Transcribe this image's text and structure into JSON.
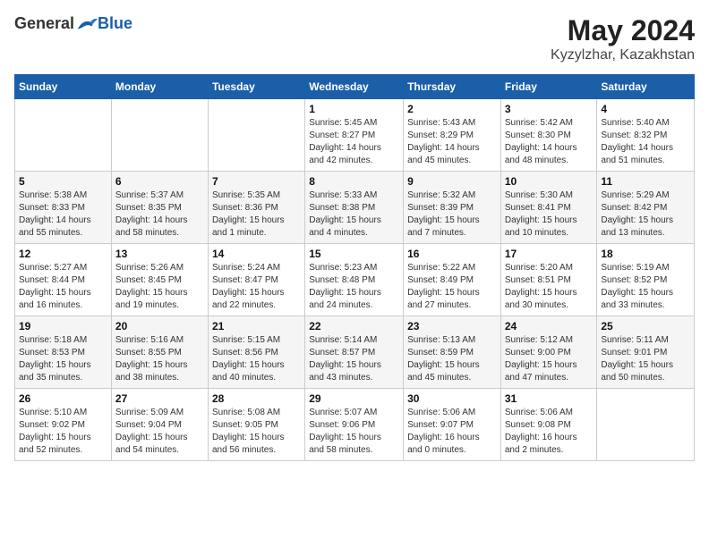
{
  "logo": {
    "general": "General",
    "blue": "Blue"
  },
  "title": {
    "month_year": "May 2024",
    "location": "Kyzylzhar, Kazakhstan"
  },
  "header_days": [
    "Sunday",
    "Monday",
    "Tuesday",
    "Wednesday",
    "Thursday",
    "Friday",
    "Saturday"
  ],
  "weeks": [
    [
      {
        "day": "",
        "info": ""
      },
      {
        "day": "",
        "info": ""
      },
      {
        "day": "",
        "info": ""
      },
      {
        "day": "1",
        "info": "Sunrise: 5:45 AM\nSunset: 8:27 PM\nDaylight: 14 hours\nand 42 minutes."
      },
      {
        "day": "2",
        "info": "Sunrise: 5:43 AM\nSunset: 8:29 PM\nDaylight: 14 hours\nand 45 minutes."
      },
      {
        "day": "3",
        "info": "Sunrise: 5:42 AM\nSunset: 8:30 PM\nDaylight: 14 hours\nand 48 minutes."
      },
      {
        "day": "4",
        "info": "Sunrise: 5:40 AM\nSunset: 8:32 PM\nDaylight: 14 hours\nand 51 minutes."
      }
    ],
    [
      {
        "day": "5",
        "info": "Sunrise: 5:38 AM\nSunset: 8:33 PM\nDaylight: 14 hours\nand 55 minutes."
      },
      {
        "day": "6",
        "info": "Sunrise: 5:37 AM\nSunset: 8:35 PM\nDaylight: 14 hours\nand 58 minutes."
      },
      {
        "day": "7",
        "info": "Sunrise: 5:35 AM\nSunset: 8:36 PM\nDaylight: 15 hours\nand 1 minute."
      },
      {
        "day": "8",
        "info": "Sunrise: 5:33 AM\nSunset: 8:38 PM\nDaylight: 15 hours\nand 4 minutes."
      },
      {
        "day": "9",
        "info": "Sunrise: 5:32 AM\nSunset: 8:39 PM\nDaylight: 15 hours\nand 7 minutes."
      },
      {
        "day": "10",
        "info": "Sunrise: 5:30 AM\nSunset: 8:41 PM\nDaylight: 15 hours\nand 10 minutes."
      },
      {
        "day": "11",
        "info": "Sunrise: 5:29 AM\nSunset: 8:42 PM\nDaylight: 15 hours\nand 13 minutes."
      }
    ],
    [
      {
        "day": "12",
        "info": "Sunrise: 5:27 AM\nSunset: 8:44 PM\nDaylight: 15 hours\nand 16 minutes."
      },
      {
        "day": "13",
        "info": "Sunrise: 5:26 AM\nSunset: 8:45 PM\nDaylight: 15 hours\nand 19 minutes."
      },
      {
        "day": "14",
        "info": "Sunrise: 5:24 AM\nSunset: 8:47 PM\nDaylight: 15 hours\nand 22 minutes."
      },
      {
        "day": "15",
        "info": "Sunrise: 5:23 AM\nSunset: 8:48 PM\nDaylight: 15 hours\nand 24 minutes."
      },
      {
        "day": "16",
        "info": "Sunrise: 5:22 AM\nSunset: 8:49 PM\nDaylight: 15 hours\nand 27 minutes."
      },
      {
        "day": "17",
        "info": "Sunrise: 5:20 AM\nSunset: 8:51 PM\nDaylight: 15 hours\nand 30 minutes."
      },
      {
        "day": "18",
        "info": "Sunrise: 5:19 AM\nSunset: 8:52 PM\nDaylight: 15 hours\nand 33 minutes."
      }
    ],
    [
      {
        "day": "19",
        "info": "Sunrise: 5:18 AM\nSunset: 8:53 PM\nDaylight: 15 hours\nand 35 minutes."
      },
      {
        "day": "20",
        "info": "Sunrise: 5:16 AM\nSunset: 8:55 PM\nDaylight: 15 hours\nand 38 minutes."
      },
      {
        "day": "21",
        "info": "Sunrise: 5:15 AM\nSunset: 8:56 PM\nDaylight: 15 hours\nand 40 minutes."
      },
      {
        "day": "22",
        "info": "Sunrise: 5:14 AM\nSunset: 8:57 PM\nDaylight: 15 hours\nand 43 minutes."
      },
      {
        "day": "23",
        "info": "Sunrise: 5:13 AM\nSunset: 8:59 PM\nDaylight: 15 hours\nand 45 minutes."
      },
      {
        "day": "24",
        "info": "Sunrise: 5:12 AM\nSunset: 9:00 PM\nDaylight: 15 hours\nand 47 minutes."
      },
      {
        "day": "25",
        "info": "Sunrise: 5:11 AM\nSunset: 9:01 PM\nDaylight: 15 hours\nand 50 minutes."
      }
    ],
    [
      {
        "day": "26",
        "info": "Sunrise: 5:10 AM\nSunset: 9:02 PM\nDaylight: 15 hours\nand 52 minutes."
      },
      {
        "day": "27",
        "info": "Sunrise: 5:09 AM\nSunset: 9:04 PM\nDaylight: 15 hours\nand 54 minutes."
      },
      {
        "day": "28",
        "info": "Sunrise: 5:08 AM\nSunset: 9:05 PM\nDaylight: 15 hours\nand 56 minutes."
      },
      {
        "day": "29",
        "info": "Sunrise: 5:07 AM\nSunset: 9:06 PM\nDaylight: 15 hours\nand 58 minutes."
      },
      {
        "day": "30",
        "info": "Sunrise: 5:06 AM\nSunset: 9:07 PM\nDaylight: 16 hours\nand 0 minutes."
      },
      {
        "day": "31",
        "info": "Sunrise: 5:06 AM\nSunset: 9:08 PM\nDaylight: 16 hours\nand 2 minutes."
      },
      {
        "day": "",
        "info": ""
      }
    ]
  ]
}
